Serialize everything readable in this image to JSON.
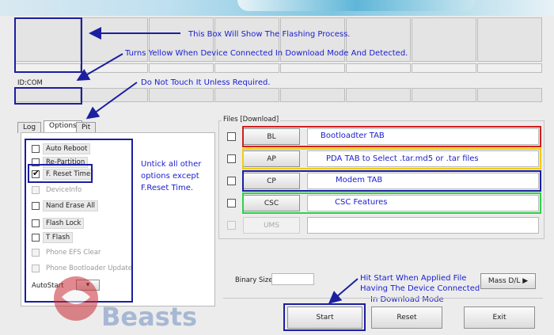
{
  "id_com_label": "ID:COM",
  "annotations": {
    "flash_process": "This Box Will Show The Flashing Process.",
    "turns_yellow": "Turns Yellow When Device Connected In Download Mode And Detected.",
    "do_not_touch": "Do Not Touch It Unless Required.",
    "untick": [
      "Untick all other",
      "options except",
      "F.Reset Time."
    ],
    "hit_start": [
      "Hit Start When Applied File",
      "Having The Device Connected",
      "In Download Mode"
    ],
    "bl_tab": "Bootloadter TAB",
    "pda_tab": "PDA TAB to Select .tar.md5 or .tar files",
    "modem_tab": "Modem TAB",
    "csc_features": "CSC Features"
  },
  "tabs": [
    {
      "label": "Log",
      "active": false
    },
    {
      "label": "Options",
      "active": true
    },
    {
      "label": "Pit",
      "active": false
    }
  ],
  "options": [
    {
      "label": "Auto Reboot",
      "checked": false,
      "enabled": true
    },
    {
      "label": "Re-Partition",
      "checked": false,
      "enabled": true
    },
    {
      "label": "F. Reset Time",
      "checked": true,
      "enabled": true
    },
    {
      "label": "DeviceInfo",
      "checked": false,
      "enabled": false
    },
    {
      "label": "Nand Erase All",
      "checked": false,
      "enabled": true
    },
    {
      "label": "Flash Lock",
      "checked": false,
      "enabled": true
    },
    {
      "label": "T Flash",
      "checked": false,
      "enabled": true
    },
    {
      "label": "Phone EFS Clear",
      "checked": false,
      "enabled": false
    },
    {
      "label": "Phone Bootloader Update",
      "checked": false,
      "enabled": false
    }
  ],
  "autostart_label": "AutoStart",
  "files_group_label": "Files [Download]",
  "files": [
    {
      "button": "BL",
      "enabled": true
    },
    {
      "button": "AP",
      "enabled": true
    },
    {
      "button": "CP",
      "enabled": true
    },
    {
      "button": "CSC",
      "enabled": true
    },
    {
      "button": "UMS",
      "enabled": false
    }
  ],
  "binary_size_label": "Binary Size",
  "mass_dl_label": "Mass D/L ▶",
  "buttons": {
    "start": "Start",
    "reset": "Reset",
    "exit": "Exit"
  },
  "watermark_text": "Beasts",
  "colors": {
    "annotation_blue": "#1b1fa0",
    "bl_red": "#d21e1e",
    "pda_yellow": "#f0cc12",
    "csc_green": "#2ed14a"
  }
}
